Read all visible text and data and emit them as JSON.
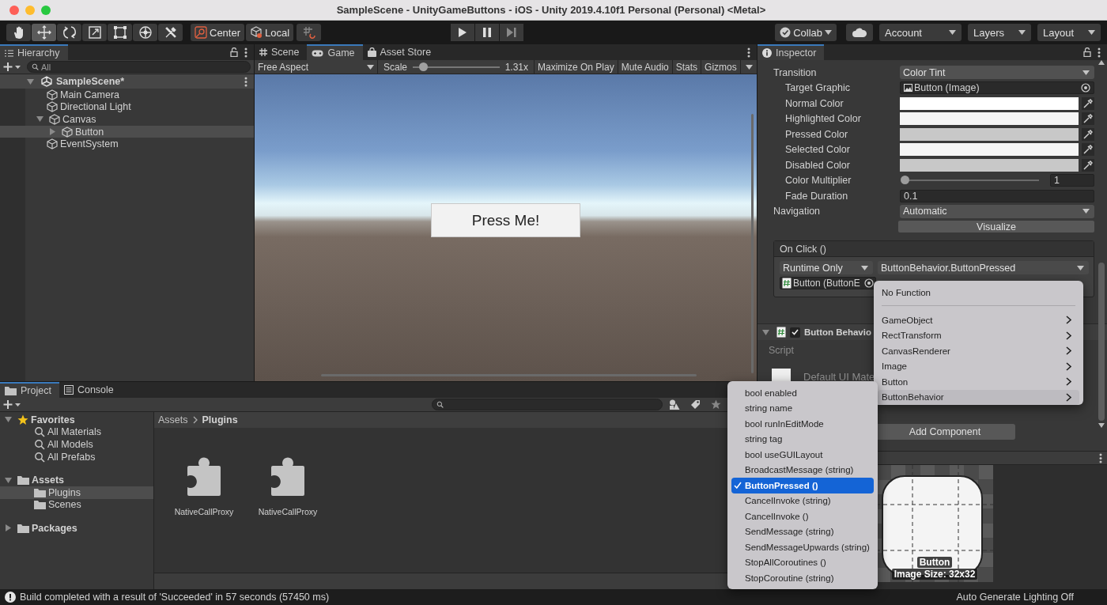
{
  "window": {
    "title": "SampleScene - UnityGameButtons - iOS - Unity 2019.4.10f1 Personal (Personal) <Metal>"
  },
  "toolbar": {
    "tools": [
      {
        "selected": false
      },
      {
        "selected": true
      },
      {
        "selected": false
      },
      {
        "selected": false
      },
      {
        "selected": false
      },
      {
        "selected": false
      },
      {
        "selected": false
      }
    ],
    "pivot": [
      "Center",
      "Local"
    ],
    "collab": "Collab",
    "account": "Account",
    "layers": "Layers",
    "layout": "Layout"
  },
  "hierarchy": {
    "tab": "Hierarchy",
    "placeholder": "All",
    "scene": "SampleScene*",
    "items": [
      {
        "label": "Main Camera",
        "selected": false
      },
      {
        "label": "Directional Light",
        "selected": false
      },
      {
        "label": "Canvas",
        "selected": false,
        "expanded": true,
        "children": [
          {
            "label": "Button",
            "selected": true,
            "expanded": false
          }
        ]
      },
      {
        "label": "EventSystem",
        "selected": false
      }
    ]
  },
  "game": {
    "tabs": [
      {
        "label": "Scene",
        "kind": "scene",
        "selected": false
      },
      {
        "label": "Game",
        "kind": "game",
        "selected": true
      },
      {
        "label": "Asset Store",
        "kind": "store",
        "selected": false
      }
    ],
    "aspect": "Free Aspect",
    "scale_label": "Scale",
    "scale": {
      "level": 0.12,
      "reading": "1.31x"
    },
    "buttons": [
      "Maximize On Play",
      "Mute Audio",
      "Stats",
      "Gizmos"
    ],
    "ui_button": "Press Me!"
  },
  "inspector": {
    "tab": "Inspector",
    "rows": [
      {
        "kind": "dropdown",
        "label": "Transition",
        "value": "Color Tint",
        "children": [
          {
            "kind": "object",
            "label": "Target Graphic",
            "value": "Button (Image)"
          },
          {
            "kind": "color",
            "label": "Normal Color",
            "color": "#ffffff"
          },
          {
            "kind": "color",
            "label": "Highlighted Color",
            "color": "#f5f5f5"
          },
          {
            "kind": "color",
            "label": "Pressed Color",
            "color": "#c8c8c8"
          },
          {
            "kind": "color",
            "label": "Selected Color",
            "color": "#f5f5f5"
          },
          {
            "kind": "color",
            "label": "Disabled Color",
            "color": "#c8c8c8"
          },
          {
            "kind": "slider",
            "label": "Color Multiplier",
            "level": 0,
            "value": "1"
          },
          {
            "kind": "number",
            "label": "Fade Duration",
            "value": "0.1"
          }
        ]
      },
      {
        "kind": "dropdown",
        "label": "Navigation",
        "value": "Automatic"
      }
    ],
    "visualize": "Visualize",
    "on_click": {
      "title": "On Click ()",
      "mode": "Runtime Only",
      "function": "ButtonBehavior.ButtonPressed",
      "target": "Button (ButtonE"
    },
    "component": {
      "title": "Button Behavio",
      "enabled": true,
      "script_label": "Script",
      "material": "Default UI Mate"
    },
    "add_component": "Add Component",
    "preview": {
      "name": "Button",
      "size": "Image Size: 32x32"
    }
  },
  "function_menu": [
    {
      "label": "No Function",
      "submenu": false,
      "selected": false
    },
    {
      "label": "GameObject",
      "submenu": true,
      "selected": false
    },
    {
      "label": "RectTransform",
      "submenu": true,
      "selected": false
    },
    {
      "label": "CanvasRenderer",
      "submenu": true,
      "selected": false
    },
    {
      "label": "Image",
      "submenu": true,
      "selected": false
    },
    {
      "label": "Button",
      "submenu": true,
      "selected": false
    },
    {
      "label": "ButtonBehavior",
      "submenu": true,
      "selected": true
    }
  ],
  "method_menu": [
    {
      "label": "bool enabled",
      "selected": false
    },
    {
      "label": "string name",
      "selected": false
    },
    {
      "label": "bool runInEditMode",
      "selected": false
    },
    {
      "label": "string tag",
      "selected": false
    },
    {
      "label": "bool useGUILayout",
      "selected": false
    },
    {
      "label": "BroadcastMessage (string)",
      "selected": false
    },
    {
      "label": "ButtonPressed ()",
      "selected": true
    },
    {
      "label": "CancelInvoke (string)",
      "selected": false
    },
    {
      "label": "CancelInvoke ()",
      "selected": false
    },
    {
      "label": "SendMessage (string)",
      "selected": false
    },
    {
      "label": "SendMessageUpwards (string)",
      "selected": false
    },
    {
      "label": "StopAllCoroutines ()",
      "selected": false
    },
    {
      "label": "StopCoroutine (string)",
      "selected": false
    }
  ],
  "project": {
    "tabs": [
      {
        "label": "Project",
        "kind": "project",
        "selected": true
      },
      {
        "label": "Console",
        "kind": "console",
        "selected": false
      }
    ],
    "tree": [
      {
        "label": "Favorites",
        "kind": "favorites",
        "selected": false,
        "expanded": true,
        "children": [
          {
            "label": "All Materials",
            "kind": "search",
            "selected": false
          },
          {
            "label": "All Models",
            "kind": "search",
            "selected": false
          },
          {
            "label": "All Prefabs",
            "kind": "search",
            "selected": false
          }
        ]
      },
      {
        "label": "Assets",
        "kind": "folder",
        "selected": false,
        "expanded": true,
        "children": [
          {
            "label": "Plugins",
            "kind": "folder",
            "selected": true
          },
          {
            "label": "Scenes",
            "kind": "folder",
            "selected": false
          }
        ]
      },
      {
        "label": "Packages",
        "kind": "folder",
        "selected": false,
        "expanded": false
      }
    ],
    "breadcrumb": [
      "Assets",
      "Plugins"
    ],
    "files": [
      "NativeCallProxy",
      "NativeCallProxy"
    ]
  },
  "status_bar": {
    "message": "Build completed with a result of 'Succeeded' in 57 seconds (57450 ms)",
    "lighting": "Auto Generate Lighting Off"
  }
}
